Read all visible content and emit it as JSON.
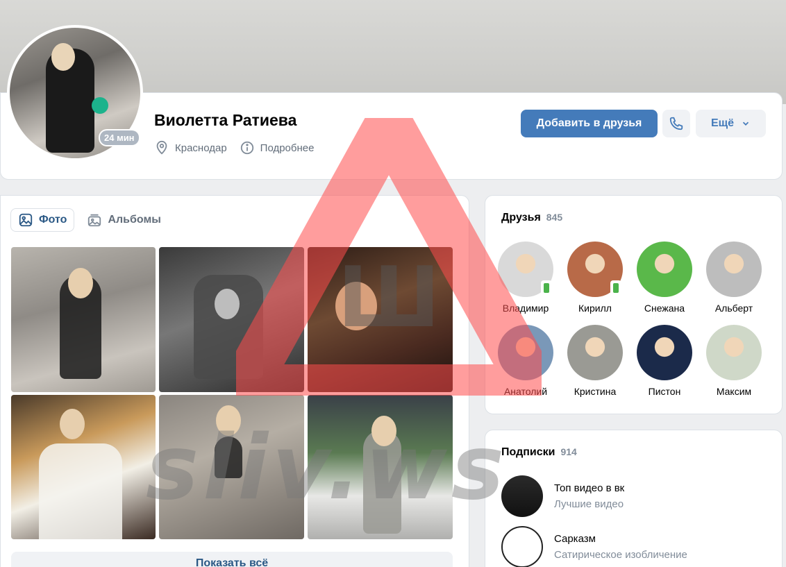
{
  "profile": {
    "name": "Виолетта Ратиева",
    "last_seen": "24 мин",
    "city": "Краснодар",
    "details_label": "Подробнее",
    "add_friend_label": "Добавить в друзья",
    "more_label": "Ещё",
    "call_icon": "phone-icon",
    "location_icon": "location-pin-icon",
    "info_icon": "info-icon"
  },
  "photos": {
    "tabs": [
      {
        "label": "Фото",
        "icon": "photo-icon",
        "active": true
      },
      {
        "label": "Альбомы",
        "icon": "albums-icon",
        "active": false
      }
    ],
    "show_all_label": "Показать всё"
  },
  "friends": {
    "title": "Друзья",
    "count": "845",
    "items": [
      {
        "name": "Владимир",
        "online": true,
        "color": "#d9d9d9"
      },
      {
        "name": "Кирилл",
        "online": true,
        "color": "#b86a48"
      },
      {
        "name": "Снежана",
        "online": false,
        "color": "#5ab84a"
      },
      {
        "name": "Альберт",
        "online": false,
        "color": "#bdbdbd"
      },
      {
        "name": "Анатолий",
        "online": false,
        "color": "#7a98b8"
      },
      {
        "name": "Кристина",
        "online": false,
        "color": "#9a9a94"
      },
      {
        "name": "Пистон",
        "online": false,
        "color": "#1b2a4a"
      },
      {
        "name": "Максим",
        "online": false,
        "color": "#cfd8c8"
      }
    ]
  },
  "subscriptions": {
    "title": "Подписки",
    "count": "914",
    "items": [
      {
        "title": "Топ видео в вк",
        "subtitle": "Лучшие видео"
      },
      {
        "title": "Сарказм",
        "subtitle": "Сатирическое изобличение"
      }
    ]
  },
  "watermark": {
    "text": "sliv.ws",
    "letter": "Ш",
    "color": "#ff4d4d"
  }
}
